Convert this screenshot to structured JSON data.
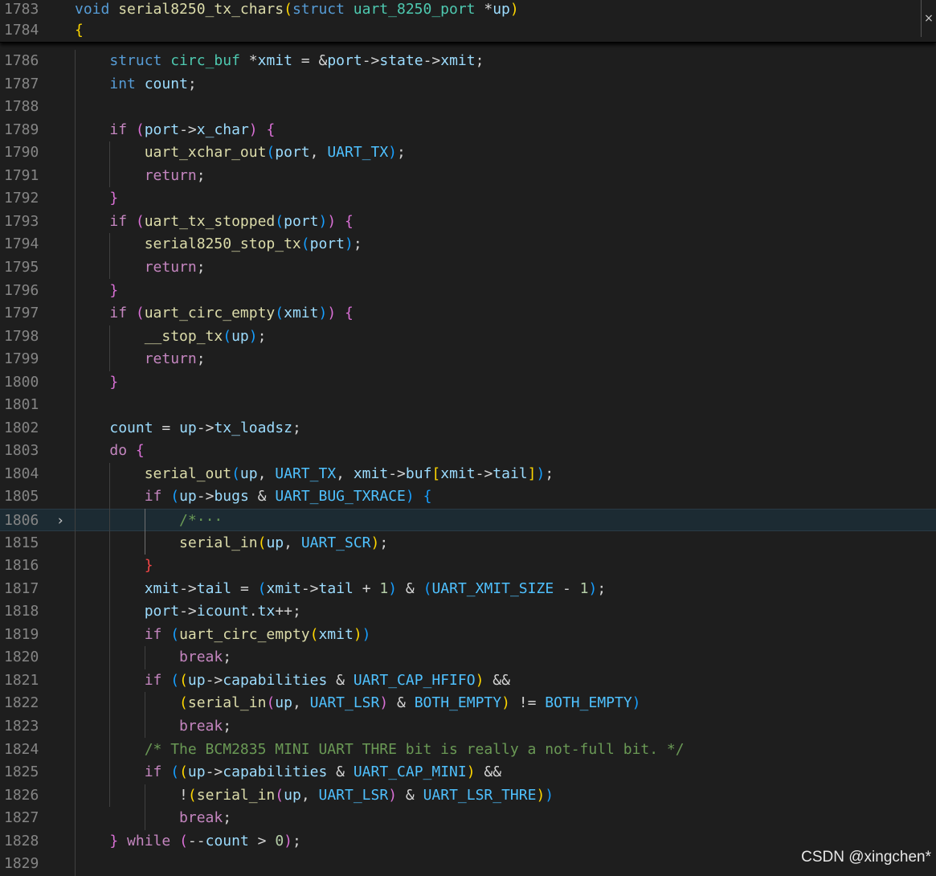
{
  "editor": {
    "sticky_lines": [
      {
        "n": "1783",
        "tokens": [
          [
            "kw",
            "void "
          ],
          [
            "fn",
            "serial8250_tx_chars"
          ],
          [
            "b1",
            "("
          ],
          [
            "kw",
            "struct "
          ],
          [
            "ty",
            "uart_8250_port "
          ],
          [
            "op",
            "*"
          ],
          [
            "var",
            "up"
          ],
          [
            "b1",
            ")"
          ]
        ]
      },
      {
        "n": "1784",
        "tokens": [
          [
            "b1",
            "{"
          ]
        ]
      }
    ],
    "lines": [
      {
        "n": "1786",
        "tokens": [
          [
            "txt",
            "    "
          ],
          [
            "kw",
            "struct "
          ],
          [
            "ty",
            "circ_buf "
          ],
          [
            "op",
            "*"
          ],
          [
            "var",
            "xmit"
          ],
          [
            "op",
            " = &"
          ],
          [
            "var",
            "port"
          ],
          [
            "op",
            "->"
          ],
          [
            "mem",
            "state"
          ],
          [
            "op",
            "->"
          ],
          [
            "mem",
            "xmit"
          ],
          [
            "op",
            ";"
          ]
        ]
      },
      {
        "n": "1787",
        "tokens": [
          [
            "txt",
            "    "
          ],
          [
            "kw",
            "int "
          ],
          [
            "var",
            "count"
          ],
          [
            "op",
            ";"
          ]
        ]
      },
      {
        "n": "1788",
        "tokens": []
      },
      {
        "n": "1789",
        "tokens": [
          [
            "txt",
            "    "
          ],
          [
            "ctl",
            "if "
          ],
          [
            "b2",
            "("
          ],
          [
            "var",
            "port"
          ],
          [
            "op",
            "->"
          ],
          [
            "mem",
            "x_char"
          ],
          [
            "b2",
            ")"
          ],
          [
            "op",
            " "
          ],
          [
            "b2",
            "{"
          ]
        ]
      },
      {
        "n": "1790",
        "tokens": [
          [
            "txt",
            "        "
          ],
          [
            "fn",
            "uart_xchar_out"
          ],
          [
            "b3",
            "("
          ],
          [
            "var",
            "port"
          ],
          [
            "op",
            ", "
          ],
          [
            "mac",
            "UART_TX"
          ],
          [
            "b3",
            ")"
          ],
          [
            "op",
            ";"
          ]
        ]
      },
      {
        "n": "1791",
        "tokens": [
          [
            "txt",
            "        "
          ],
          [
            "ctl",
            "return"
          ],
          [
            "op",
            ";"
          ]
        ]
      },
      {
        "n": "1792",
        "tokens": [
          [
            "txt",
            "    "
          ],
          [
            "b2",
            "}"
          ]
        ]
      },
      {
        "n": "1793",
        "tokens": [
          [
            "txt",
            "    "
          ],
          [
            "ctl",
            "if "
          ],
          [
            "b2",
            "("
          ],
          [
            "fn",
            "uart_tx_stopped"
          ],
          [
            "b3",
            "("
          ],
          [
            "var",
            "port"
          ],
          [
            "b3",
            ")"
          ],
          [
            "b2",
            ")"
          ],
          [
            "op",
            " "
          ],
          [
            "b2",
            "{"
          ]
        ]
      },
      {
        "n": "1794",
        "tokens": [
          [
            "txt",
            "        "
          ],
          [
            "fn",
            "serial8250_stop_tx"
          ],
          [
            "b3",
            "("
          ],
          [
            "var",
            "port"
          ],
          [
            "b3",
            ")"
          ],
          [
            "op",
            ";"
          ]
        ]
      },
      {
        "n": "1795",
        "tokens": [
          [
            "txt",
            "        "
          ],
          [
            "ctl",
            "return"
          ],
          [
            "op",
            ";"
          ]
        ]
      },
      {
        "n": "1796",
        "tokens": [
          [
            "txt",
            "    "
          ],
          [
            "b2",
            "}"
          ]
        ]
      },
      {
        "n": "1797",
        "tokens": [
          [
            "txt",
            "    "
          ],
          [
            "ctl",
            "if "
          ],
          [
            "b2",
            "("
          ],
          [
            "fn",
            "uart_circ_empty"
          ],
          [
            "b3",
            "("
          ],
          [
            "var",
            "xmit"
          ],
          [
            "b3",
            ")"
          ],
          [
            "b2",
            ")"
          ],
          [
            "op",
            " "
          ],
          [
            "b2",
            "{"
          ]
        ]
      },
      {
        "n": "1798",
        "tokens": [
          [
            "txt",
            "        "
          ],
          [
            "fn",
            "__stop_tx"
          ],
          [
            "b3",
            "("
          ],
          [
            "var",
            "up"
          ],
          [
            "b3",
            ")"
          ],
          [
            "op",
            ";"
          ]
        ]
      },
      {
        "n": "1799",
        "tokens": [
          [
            "txt",
            "        "
          ],
          [
            "ctl",
            "return"
          ],
          [
            "op",
            ";"
          ]
        ]
      },
      {
        "n": "1800",
        "tokens": [
          [
            "txt",
            "    "
          ],
          [
            "b2",
            "}"
          ]
        ]
      },
      {
        "n": "1801",
        "tokens": []
      },
      {
        "n": "1802",
        "tokens": [
          [
            "txt",
            "    "
          ],
          [
            "var",
            "count"
          ],
          [
            "op",
            " = "
          ],
          [
            "var",
            "up"
          ],
          [
            "op",
            "->"
          ],
          [
            "mem",
            "tx_loadsz"
          ],
          [
            "op",
            ";"
          ]
        ]
      },
      {
        "n": "1803",
        "tokens": [
          [
            "txt",
            "    "
          ],
          [
            "ctl",
            "do "
          ],
          [
            "b2",
            "{"
          ]
        ]
      },
      {
        "n": "1804",
        "tokens": [
          [
            "txt",
            "        "
          ],
          [
            "fn",
            "serial_out"
          ],
          [
            "b3",
            "("
          ],
          [
            "var",
            "up"
          ],
          [
            "op",
            ", "
          ],
          [
            "mac",
            "UART_TX"
          ],
          [
            "op",
            ", "
          ],
          [
            "var",
            "xmit"
          ],
          [
            "op",
            "->"
          ],
          [
            "mem",
            "buf"
          ],
          [
            "b1",
            "["
          ],
          [
            "var",
            "xmit"
          ],
          [
            "op",
            "->"
          ],
          [
            "mem",
            "tail"
          ],
          [
            "b1",
            "]"
          ],
          [
            "b3",
            ")"
          ],
          [
            "op",
            ";"
          ]
        ]
      },
      {
        "n": "1805",
        "tokens": [
          [
            "txt",
            "        "
          ],
          [
            "ctl",
            "if "
          ],
          [
            "b3",
            "("
          ],
          [
            "var",
            "up"
          ],
          [
            "op",
            "->"
          ],
          [
            "mem",
            "bugs"
          ],
          [
            "op",
            " & "
          ],
          [
            "mac",
            "UART_BUG_TXRACE"
          ],
          [
            "b3",
            ")"
          ],
          [
            "op",
            " "
          ],
          [
            "b3",
            "{"
          ]
        ]
      },
      {
        "n": "1806",
        "fold": true,
        "hl": true,
        "tokens": [
          [
            "txt",
            "            "
          ],
          [
            "cm",
            "/*"
          ],
          [
            "cm",
            "···"
          ]
        ]
      },
      {
        "n": "1815",
        "tokens": [
          [
            "txt",
            "            "
          ],
          [
            "fn",
            "serial_in"
          ],
          [
            "b1",
            "("
          ],
          [
            "var",
            "up"
          ],
          [
            "op",
            ", "
          ],
          [
            "mac",
            "UART_SCR"
          ],
          [
            "b1",
            ")"
          ],
          [
            "op",
            ";"
          ]
        ]
      },
      {
        "n": "1816",
        "tokens": [
          [
            "txt",
            "        "
          ],
          [
            "b1r",
            "}"
          ]
        ]
      },
      {
        "n": "1817",
        "tokens": [
          [
            "txt",
            "        "
          ],
          [
            "var",
            "xmit"
          ],
          [
            "op",
            "->"
          ],
          [
            "mem",
            "tail"
          ],
          [
            "op",
            " = "
          ],
          [
            "b3",
            "("
          ],
          [
            "var",
            "xmit"
          ],
          [
            "op",
            "->"
          ],
          [
            "mem",
            "tail"
          ],
          [
            "op",
            " + "
          ],
          [
            "num",
            "1"
          ],
          [
            "b3",
            ")"
          ],
          [
            "op",
            " & "
          ],
          [
            "b3",
            "("
          ],
          [
            "mac",
            "UART_XMIT_SIZE"
          ],
          [
            "op",
            " - "
          ],
          [
            "num",
            "1"
          ],
          [
            "b3",
            ")"
          ],
          [
            "op",
            ";"
          ]
        ]
      },
      {
        "n": "1818",
        "tokens": [
          [
            "txt",
            "        "
          ],
          [
            "var",
            "port"
          ],
          [
            "op",
            "->"
          ],
          [
            "mem",
            "icount"
          ],
          [
            "op",
            "."
          ],
          [
            "mem",
            "tx"
          ],
          [
            "op",
            "++;"
          ]
        ]
      },
      {
        "n": "1819",
        "tokens": [
          [
            "txt",
            "        "
          ],
          [
            "ctl",
            "if "
          ],
          [
            "b3",
            "("
          ],
          [
            "fn",
            "uart_circ_empty"
          ],
          [
            "b1",
            "("
          ],
          [
            "var",
            "xmit"
          ],
          [
            "b1",
            ")"
          ],
          [
            "b3",
            ")"
          ]
        ]
      },
      {
        "n": "1820",
        "tokens": [
          [
            "txt",
            "            "
          ],
          [
            "ctl",
            "break"
          ],
          [
            "op",
            ";"
          ]
        ]
      },
      {
        "n": "1821",
        "tokens": [
          [
            "txt",
            "        "
          ],
          [
            "ctl",
            "if "
          ],
          [
            "b3",
            "("
          ],
          [
            "b1",
            "("
          ],
          [
            "var",
            "up"
          ],
          [
            "op",
            "->"
          ],
          [
            "mem",
            "capabilities"
          ],
          [
            "op",
            " & "
          ],
          [
            "mac",
            "UART_CAP_HFIFO"
          ],
          [
            "b1",
            ")"
          ],
          [
            "op",
            " &&"
          ]
        ]
      },
      {
        "n": "1822",
        "tokens": [
          [
            "txt",
            "            "
          ],
          [
            "b1",
            "("
          ],
          [
            "fn",
            "serial_in"
          ],
          [
            "b2",
            "("
          ],
          [
            "var",
            "up"
          ],
          [
            "op",
            ", "
          ],
          [
            "mac",
            "UART_LSR"
          ],
          [
            "b2",
            ")"
          ],
          [
            "op",
            " & "
          ],
          [
            "mac",
            "BOTH_EMPTY"
          ],
          [
            "b1",
            ")"
          ],
          [
            "op",
            " != "
          ],
          [
            "mac",
            "BOTH_EMPTY"
          ],
          [
            "b3",
            ")"
          ]
        ]
      },
      {
        "n": "1823",
        "tokens": [
          [
            "txt",
            "            "
          ],
          [
            "ctl",
            "break"
          ],
          [
            "op",
            ";"
          ]
        ]
      },
      {
        "n": "1824",
        "tokens": [
          [
            "txt",
            "        "
          ],
          [
            "cm",
            "/* The BCM2835 MINI UART THRE bit is really a not-full bit. */"
          ]
        ]
      },
      {
        "n": "1825",
        "tokens": [
          [
            "txt",
            "        "
          ],
          [
            "ctl",
            "if "
          ],
          [
            "b3",
            "("
          ],
          [
            "b1",
            "("
          ],
          [
            "var",
            "up"
          ],
          [
            "op",
            "->"
          ],
          [
            "mem",
            "capabilities"
          ],
          [
            "op",
            " & "
          ],
          [
            "mac",
            "UART_CAP_MINI"
          ],
          [
            "b1",
            ")"
          ],
          [
            "op",
            " &&"
          ]
        ]
      },
      {
        "n": "1826",
        "tokens": [
          [
            "txt",
            "            "
          ],
          [
            "op",
            "!"
          ],
          [
            "b1",
            "("
          ],
          [
            "fn",
            "serial_in"
          ],
          [
            "b2",
            "("
          ],
          [
            "var",
            "up"
          ],
          [
            "op",
            ", "
          ],
          [
            "mac",
            "UART_LSR"
          ],
          [
            "b2",
            ")"
          ],
          [
            "op",
            " & "
          ],
          [
            "mac",
            "UART_LSR_THRE"
          ],
          [
            "b1",
            ")"
          ],
          [
            "b3",
            ")"
          ]
        ]
      },
      {
        "n": "1827",
        "tokens": [
          [
            "txt",
            "            "
          ],
          [
            "ctl",
            "break"
          ],
          [
            "op",
            ";"
          ]
        ]
      },
      {
        "n": "1828",
        "tokens": [
          [
            "txt",
            "    "
          ],
          [
            "b2",
            "}"
          ],
          [
            "op",
            " "
          ],
          [
            "ctl",
            "while "
          ],
          [
            "b2",
            "("
          ],
          [
            "op",
            "--"
          ],
          [
            "var",
            "count"
          ],
          [
            "op",
            " > "
          ],
          [
            "num",
            "0"
          ],
          [
            "b2",
            ")"
          ],
          [
            "op",
            ";"
          ]
        ]
      },
      {
        "n": "1829",
        "tokens": []
      }
    ],
    "close_glyph": "×",
    "fold_glyph": "›"
  },
  "watermark": "CSDN @xingchen*"
}
